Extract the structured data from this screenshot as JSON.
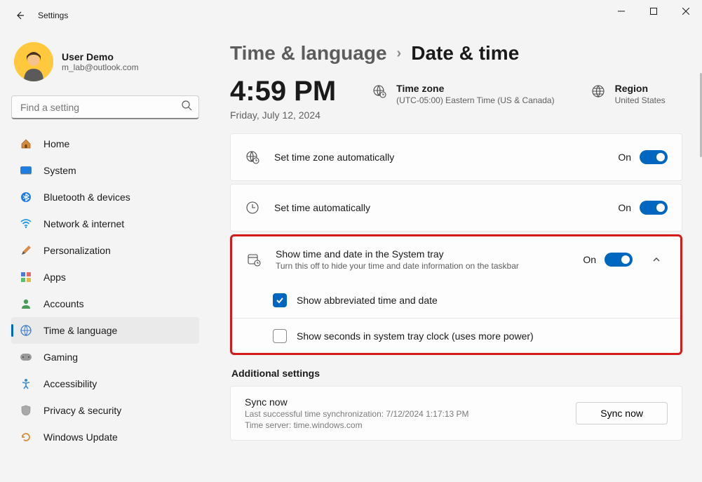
{
  "window": {
    "title": "Settings"
  },
  "user": {
    "name": "User Demo",
    "email": "m_lab@outlook.com"
  },
  "search": {
    "placeholder": "Find a setting"
  },
  "sidebar": {
    "items": [
      {
        "label": "Home"
      },
      {
        "label": "System"
      },
      {
        "label": "Bluetooth & devices"
      },
      {
        "label": "Network & internet"
      },
      {
        "label": "Personalization"
      },
      {
        "label": "Apps"
      },
      {
        "label": "Accounts"
      },
      {
        "label": "Time & language"
      },
      {
        "label": "Gaming"
      },
      {
        "label": "Accessibility"
      },
      {
        "label": "Privacy & security"
      },
      {
        "label": "Windows Update"
      }
    ]
  },
  "breadcrumb": {
    "parent": "Time & language",
    "current": "Date & time"
  },
  "clock": {
    "time": "4:59 PM",
    "date": "Friday, July 12, 2024"
  },
  "timezone": {
    "label": "Time zone",
    "value": "(UTC-05:00) Eastern Time (US & Canada)"
  },
  "region": {
    "label": "Region",
    "value": "United States"
  },
  "settings": {
    "auto_tz": {
      "title": "Set time zone automatically",
      "state": "On"
    },
    "auto_time": {
      "title": "Set time automatically",
      "state": "On"
    },
    "systray": {
      "title": "Show time and date in the System tray",
      "subtitle": "Turn this off to hide your time and date information on the taskbar",
      "state": "On",
      "abbrev": {
        "label": "Show abbreviated time and date"
      },
      "seconds": {
        "label": "Show seconds in system tray clock (uses more power)"
      }
    }
  },
  "additional": {
    "header": "Additional settings",
    "sync": {
      "title": "Sync now",
      "last": "Last successful time synchronization: 7/12/2024 1:17:13 PM",
      "server": "Time server: time.windows.com",
      "button": "Sync now"
    }
  }
}
